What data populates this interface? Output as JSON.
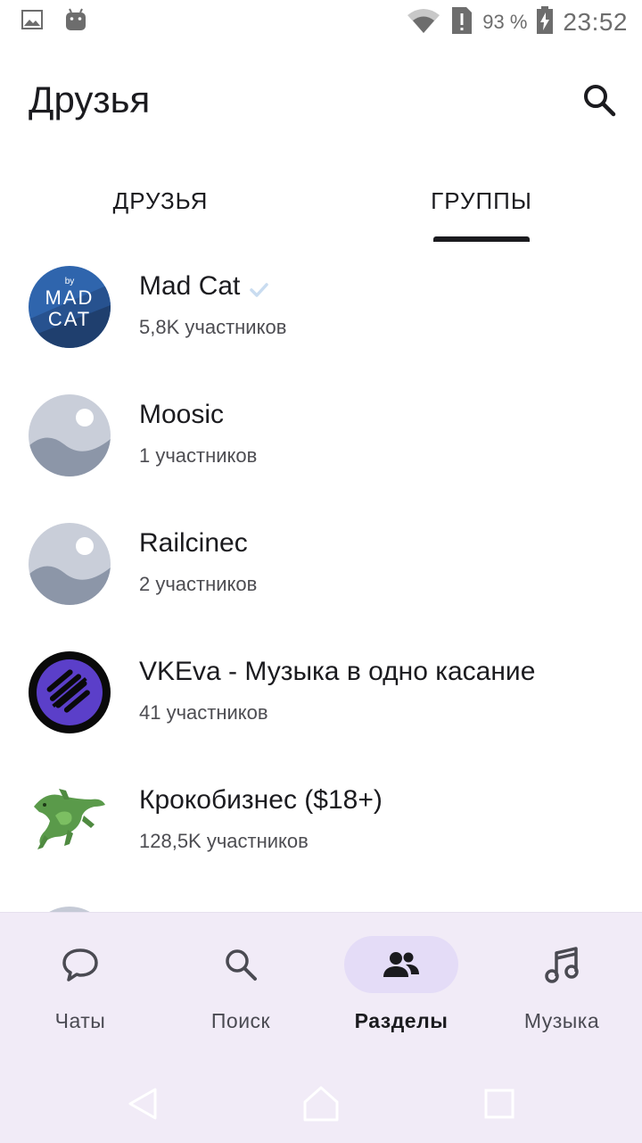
{
  "status_bar": {
    "battery_percent": "93 %",
    "time": "23:52",
    "icons": [
      "image-icon",
      "android-icon",
      "wifi-icon",
      "sim-alert-icon",
      "battery-charging-icon"
    ]
  },
  "header": {
    "title": "Друзья",
    "search_icon": "search-icon"
  },
  "tabs": [
    {
      "label": "ДРУЗЬЯ",
      "selected": false
    },
    {
      "label": "ГРУППЫ",
      "selected": true
    }
  ],
  "groups": [
    {
      "name": "Mad Cat",
      "members": "5,8K участников",
      "verified": true,
      "avatar": "mad-cat-logo"
    },
    {
      "name": "Moosic",
      "members": "1 участников",
      "verified": false,
      "avatar": "placeholder"
    },
    {
      "name": "Railcinec",
      "members": "2 участников",
      "verified": false,
      "avatar": "placeholder"
    },
    {
      "name": "VKEva - Музыка в одно касание",
      "members": "41 участников",
      "verified": false,
      "avatar": "vkeva-logo"
    },
    {
      "name": "Крокобизнес ($18+)",
      "members": "128,5K участников",
      "verified": false,
      "avatar": "crocodile"
    }
  ],
  "avatar_logo_text": {
    "by": "by",
    "line1": "MAD",
    "line2": "CAT"
  },
  "bottom_nav": [
    {
      "label": "Чаты",
      "icon": "chat-icon",
      "active": false
    },
    {
      "label": "Поиск",
      "icon": "search-icon",
      "active": false
    },
    {
      "label": "Разделы",
      "icon": "people-icon",
      "active": true
    },
    {
      "label": "Музыка",
      "icon": "music-icon",
      "active": false
    }
  ],
  "colors": {
    "nav_background": "#f1ebf7",
    "active_pill": "#e4dcf7",
    "text_primary": "#1b1b1f",
    "text_secondary": "#4d4d52",
    "verified_check": "#c9dcf0"
  }
}
